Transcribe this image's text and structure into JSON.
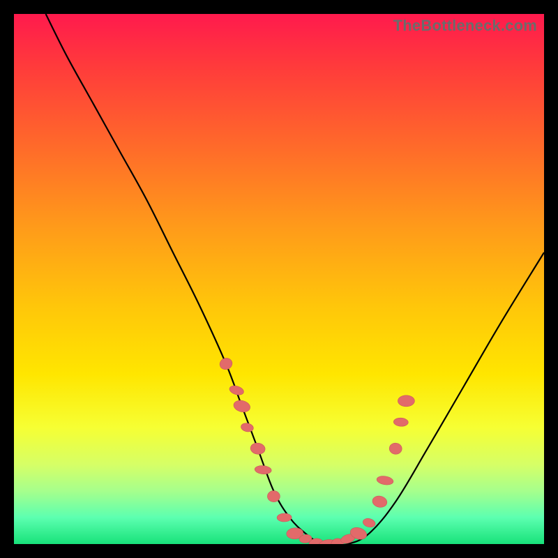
{
  "watermark": "TheBottleneck.com",
  "chart_data": {
    "type": "line",
    "title": "",
    "xlabel": "",
    "ylabel": "",
    "xlim": [
      0,
      100
    ],
    "ylim": [
      0,
      100
    ],
    "background_gradient": {
      "top": "#ff1a4d",
      "mid": "#ffe600",
      "bottom": "#18e27a"
    },
    "series": [
      {
        "name": "bottleneck-curve",
        "x": [
          6,
          10,
          15,
          20,
          25,
          30,
          35,
          40,
          43,
          46,
          49,
          52,
          55,
          58,
          60,
          63,
          67,
          72,
          78,
          85,
          92,
          100
        ],
        "y": [
          100,
          92,
          83,
          74,
          65,
          55,
          45,
          34,
          26,
          18,
          10,
          5,
          2,
          0,
          0,
          0,
          2,
          8,
          18,
          30,
          42,
          55
        ],
        "color": "#000000"
      }
    ],
    "markers": {
      "name": "highlight-points",
      "color": "#e26a6a",
      "points": [
        {
          "x": 40,
          "y": 34
        },
        {
          "x": 42,
          "y": 29
        },
        {
          "x": 43,
          "y": 26
        },
        {
          "x": 44,
          "y": 22
        },
        {
          "x": 46,
          "y": 18
        },
        {
          "x": 47,
          "y": 14
        },
        {
          "x": 49,
          "y": 9
        },
        {
          "x": 51,
          "y": 5
        },
        {
          "x": 53,
          "y": 2
        },
        {
          "x": 55,
          "y": 1
        },
        {
          "x": 57,
          "y": 0
        },
        {
          "x": 59,
          "y": 0
        },
        {
          "x": 61,
          "y": 0
        },
        {
          "x": 63,
          "y": 1
        },
        {
          "x": 65,
          "y": 2
        },
        {
          "x": 67,
          "y": 4
        },
        {
          "x": 69,
          "y": 8
        },
        {
          "x": 70,
          "y": 12
        },
        {
          "x": 72,
          "y": 18
        },
        {
          "x": 73,
          "y": 23
        },
        {
          "x": 74,
          "y": 27
        }
      ]
    }
  }
}
